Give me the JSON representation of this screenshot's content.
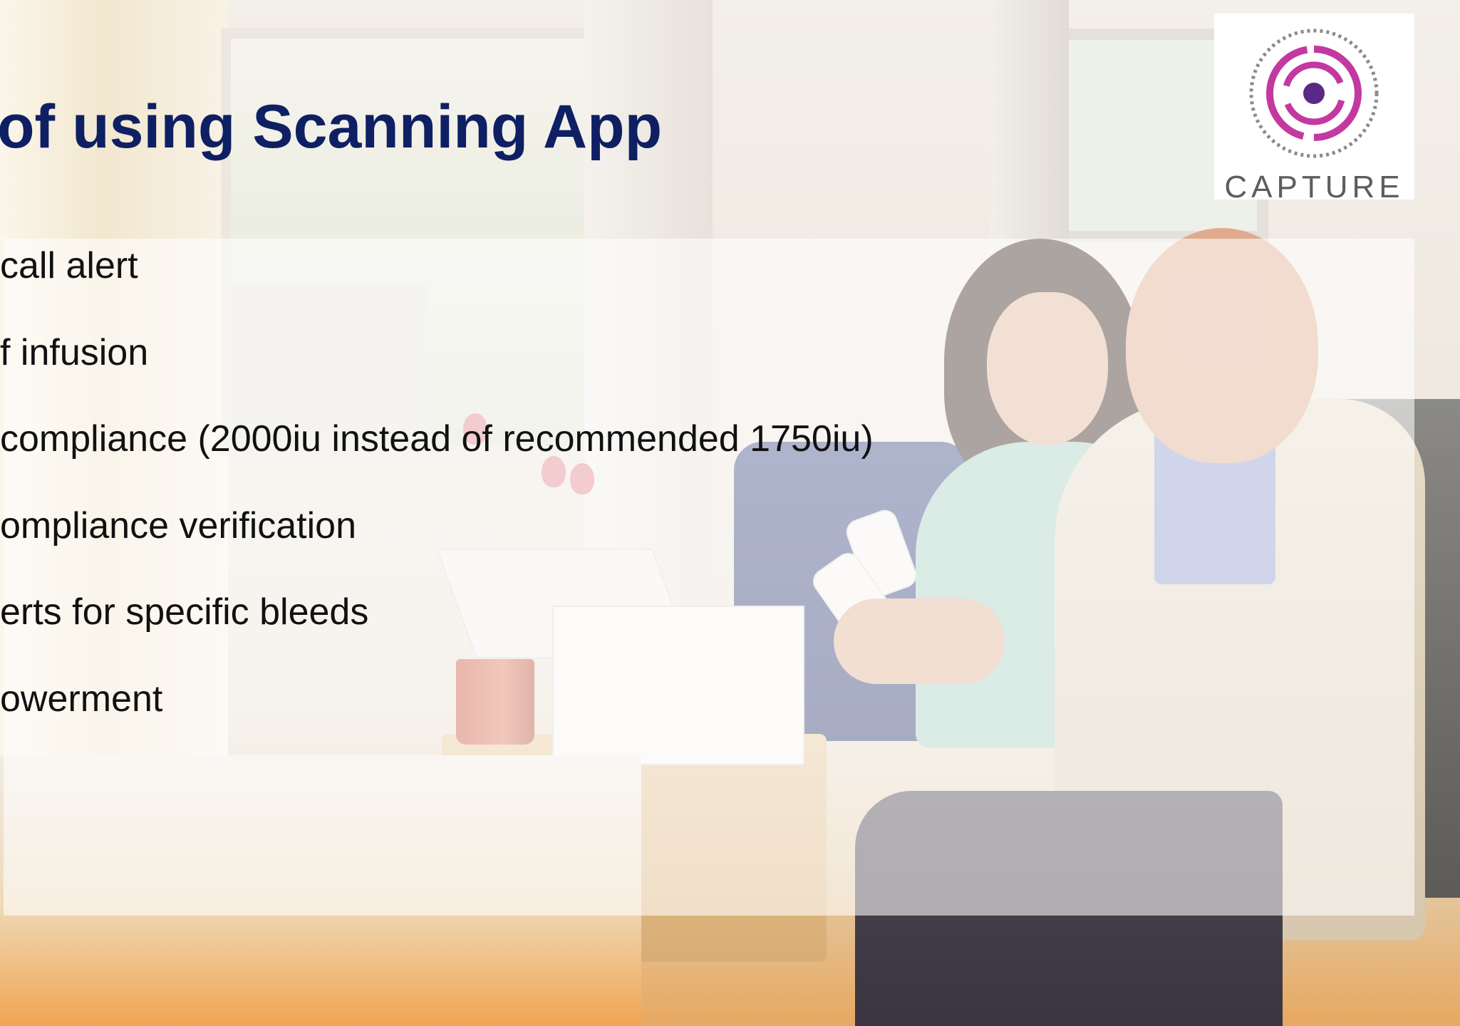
{
  "slide": {
    "title": "of using Scanning App",
    "bullets": [
      "call alert",
      "f infusion",
      "compliance (2000iu instead of recommended 1750iu)",
      "ompliance verification",
      "erts for specific bleeds",
      "owerment"
    ]
  },
  "logo": {
    "text": "CAPTURE",
    "icon": "capture-target-icon",
    "colors": {
      "magenta": "#c2399f",
      "purple": "#5a2a86",
      "ring": "#8a8a8a"
    }
  },
  "colors": {
    "title": "#0f1f63",
    "body_text": "#111111",
    "panel": "rgba(255,255,255,0.58)"
  }
}
